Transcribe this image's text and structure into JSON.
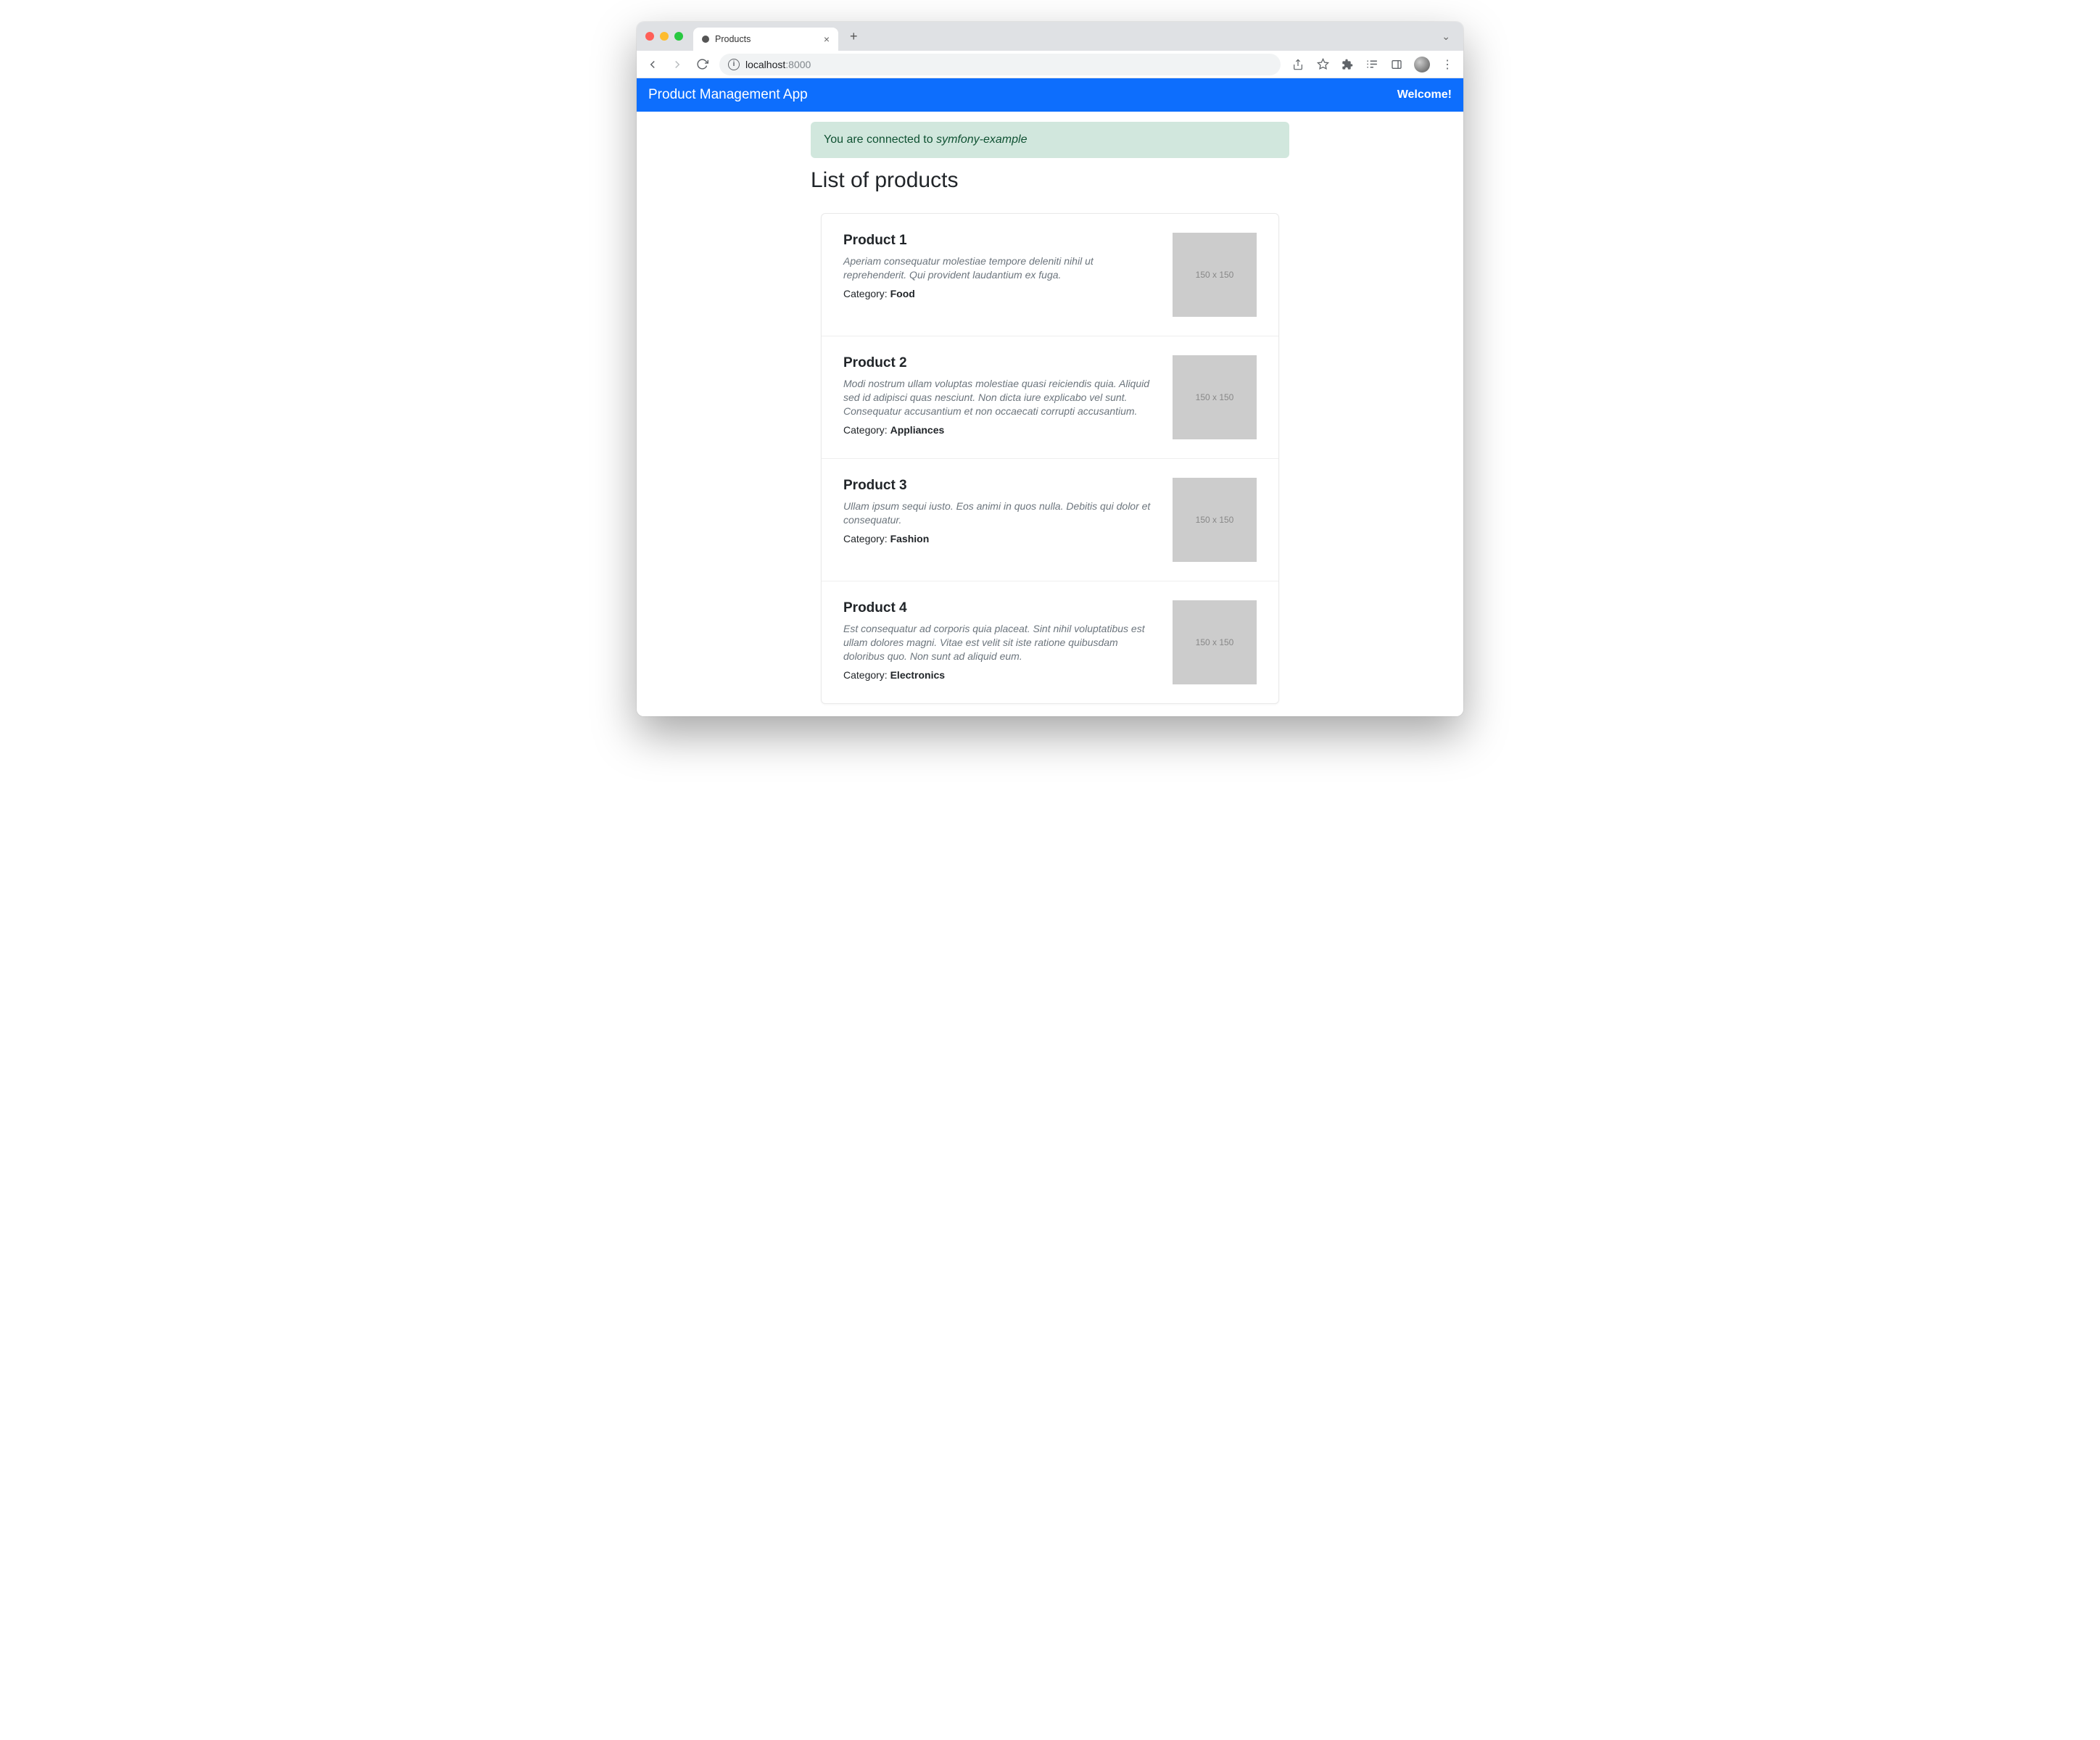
{
  "browser": {
    "tab_title": "Products",
    "url_host": "localhost",
    "url_port": ":8000"
  },
  "navbar": {
    "brand": "Product Management App",
    "welcome": "Welcome!"
  },
  "alert": {
    "prefix": "You are connected to ",
    "db": "symfony-example"
  },
  "page": {
    "heading": "List of products"
  },
  "labels": {
    "category_prefix": "Category: "
  },
  "placeholder": {
    "size_label": "150 x 150"
  },
  "products": [
    {
      "title": "Product 1",
      "description": "Aperiam consequatur molestiae tempore deleniti nihil ut reprehenderit. Qui provident laudantium ex fuga.",
      "category": "Food"
    },
    {
      "title": "Product 2",
      "description": "Modi nostrum ullam voluptas molestiae quasi reiciendis quia. Aliquid sed id adipisci quas nesciunt. Non dicta iure explicabo vel sunt. Consequatur accusantium et non occaecati corrupti accusantium.",
      "category": "Appliances"
    },
    {
      "title": "Product 3",
      "description": "Ullam ipsum sequi iusto. Eos animi in quos nulla. Debitis qui dolor et consequatur.",
      "category": "Fashion"
    },
    {
      "title": "Product 4",
      "description": "Est consequatur ad corporis quia placeat. Sint nihil voluptatibus est ullam dolores magni. Vitae est velit sit iste ratione quibusdam doloribus quo. Non sunt ad aliquid eum.",
      "category": "Electronics"
    }
  ]
}
